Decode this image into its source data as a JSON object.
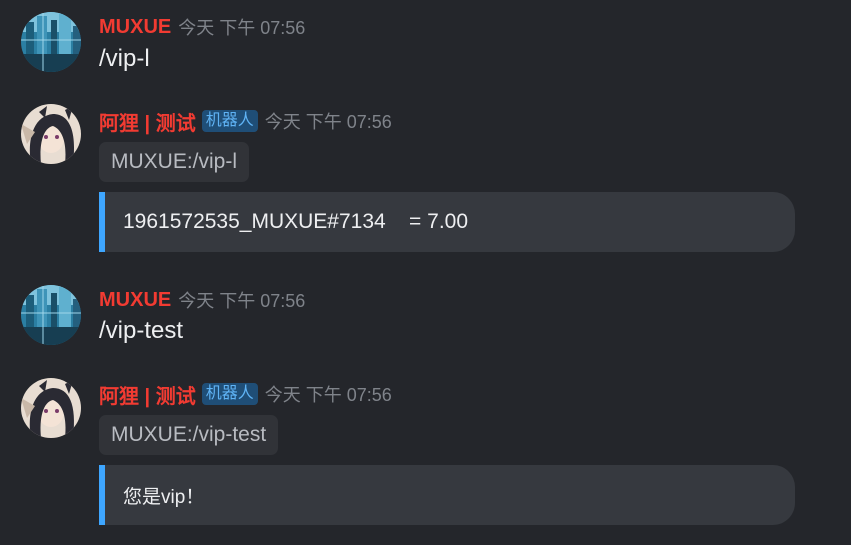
{
  "messages": [
    {
      "author": "MUXUE",
      "time": "今天 下午 07:56",
      "text": "/vip-l",
      "avatar_icon": "blue-city-avatar"
    },
    {
      "author": "阿狸 | 测试",
      "bot_tag": "机器人",
      "time": "今天 下午 07:56",
      "quote": "MUXUE:/vip-l",
      "embed": "1961572535_MUXUE#7134    = 7.00",
      "avatar_icon": "anime-girl-avatar"
    },
    {
      "author": "MUXUE",
      "time": "今天 下午 07:56",
      "text": "/vip-test",
      "avatar_icon": "blue-city-avatar"
    },
    {
      "author": "阿狸 | 测试",
      "bot_tag": "机器人",
      "time": "今天 下午 07:56",
      "quote": "MUXUE:/vip-test",
      "embed": "您是vip！",
      "avatar_icon": "anime-girl-avatar"
    }
  ],
  "colors": {
    "background": "#24262b",
    "author_name": "#f23b32",
    "bot_tag_bg": "#1f4e77",
    "bot_tag_text": "#5fb3f5",
    "embed_bar": "#3ea6ff",
    "timestamp": "#7f838a"
  }
}
